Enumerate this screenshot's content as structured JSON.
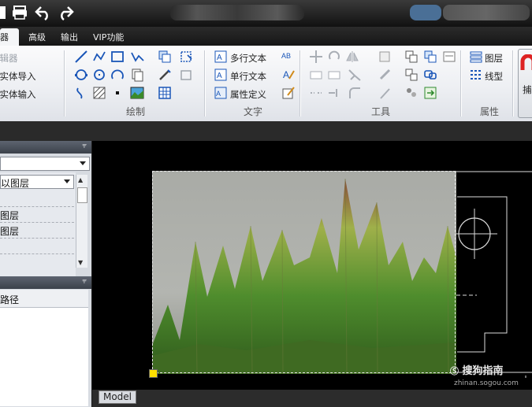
{
  "tabs": [
    {
      "label": "编辑器",
      "visible_text": "器"
    },
    {
      "label": "高级"
    },
    {
      "label": "输出"
    },
    {
      "label": "VIP功能"
    }
  ],
  "ribbon": {
    "partial_group": {
      "items": [
        "编辑器",
        "速实体导入",
        "形实体输入"
      ]
    },
    "draw_group_label": "绘制",
    "text_group": {
      "label": "文字",
      "multiline": "多行文本",
      "singleline": "单行文本",
      "attribute": "属性定义"
    },
    "tools_group_label": "工具",
    "props_group": {
      "label": "属性",
      "layer": "图层",
      "linetype": "线型"
    },
    "capture_label": "捕"
  },
  "left_panel": {
    "layer_combo": "以图层",
    "list_items": [
      "图层",
      "图层"
    ],
    "path_header": "路径"
  },
  "canvas": {
    "model_tab": "Model"
  },
  "watermark": {
    "brand": "搜狗指南",
    "url": "zhinan.sogou.com"
  },
  "colors": {
    "ribbon_bg": "#eceef2",
    "canvas_bg": "#000000",
    "grip": "#ffe000"
  }
}
